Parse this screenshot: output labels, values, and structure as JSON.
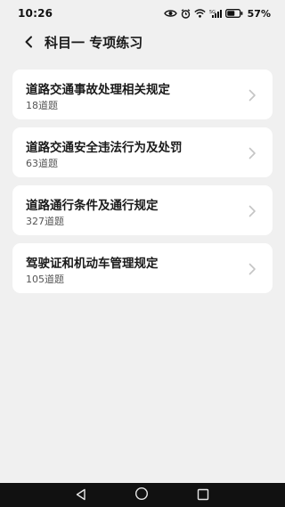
{
  "status_bar": {
    "time": "10:26",
    "battery_percent": "57%",
    "network_label": "5G"
  },
  "header": {
    "title": "科目一 专项练习"
  },
  "items": [
    {
      "title": "道路交通事故处理相关规定",
      "count": "18道题"
    },
    {
      "title": "道路交通安全违法行为及处罚",
      "count": "63道题"
    },
    {
      "title": "道路通行条件及通行规定",
      "count": "327道题"
    },
    {
      "title": "驾驶证和机动车管理规定",
      "count": "105道题"
    }
  ],
  "colors": {
    "background": "#f0f0f0",
    "card": "#ffffff",
    "nav_bar": "#111111",
    "chevron": "#c4c4c4"
  }
}
